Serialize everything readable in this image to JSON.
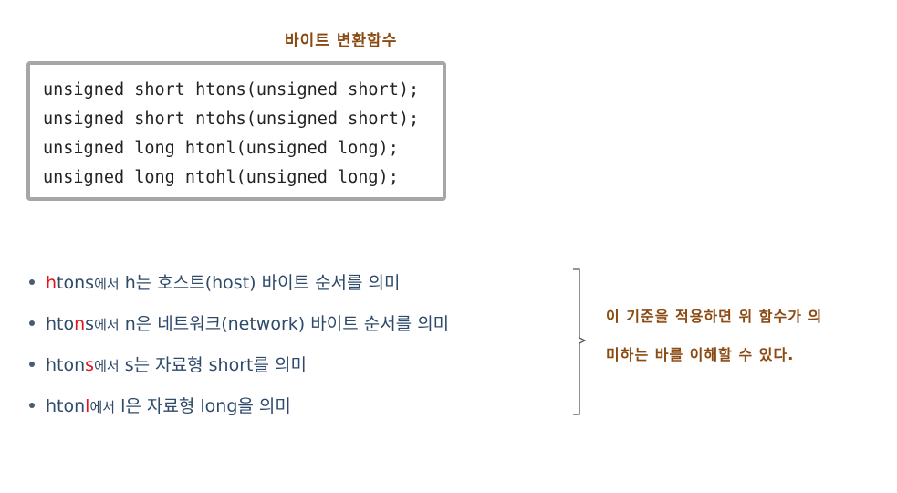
{
  "title": "바이트 변환함수",
  "code_lines": [
    "unsigned short htons(unsigned short);",
    "unsigned short ntohs(unsigned short);",
    "unsigned long htonl(unsigned long);",
    "unsigned long ntohl(unsigned long);"
  ],
  "bullets": [
    {
      "pre": "",
      "hl": "h",
      "post": "tons",
      "rest_small": "에서",
      "desc": " h는 호스트(host) 바이트 순서를 의미"
    },
    {
      "pre": "hto",
      "hl": "n",
      "post": "s",
      "rest_small": "에서",
      "desc": " n은 네트워크(network) 바이트 순서를 의미"
    },
    {
      "pre": "hton",
      "hl": "s",
      "post": "",
      "rest_small": "에서",
      "desc": " s는 자료형 short를 의미"
    },
    {
      "pre": "hton",
      "hl": "l",
      "post": "",
      "rest_small": "에서",
      "desc": " l은 자료형 long을 의미"
    }
  ],
  "note": {
    "line1": "이 기준을 적용하면 위 함수가 의",
    "line2": "미하는 바를 이해할 수 있다."
  },
  "colors": {
    "title": "#8b4a12",
    "bullet_text": "#2e4a6b",
    "highlight": "#e4141b",
    "box_border": "#a6a6a6"
  }
}
